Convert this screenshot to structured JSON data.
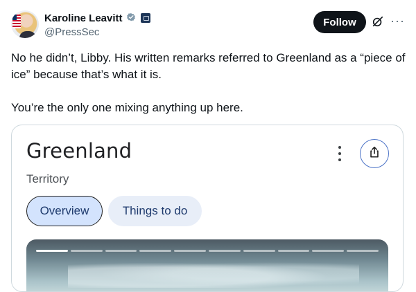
{
  "author": {
    "display_name": "Karoline Leavitt",
    "handle": "@PressSec",
    "verified_color": "#829aab"
  },
  "actions": {
    "follow_label": "Follow",
    "more_icon": "more-horizontal-icon",
    "grok_icon": "grok-icon"
  },
  "tweet": {
    "paragraphs": [
      "No he didn’t, Libby. His written remarks referred to Greenland as a “piece of ice” because that’s what it is.",
      "You’re the only one mixing anything up here."
    ]
  },
  "card": {
    "title": "Greenland",
    "subtitle": "Territory",
    "tabs": [
      {
        "label": "Overview",
        "selected": true
      },
      {
        "label": "Things to do",
        "selected": false
      }
    ],
    "share_icon": "share-icon",
    "accent_color": "#0b57d0",
    "image_slide_count": 10,
    "active_slide": 1
  }
}
